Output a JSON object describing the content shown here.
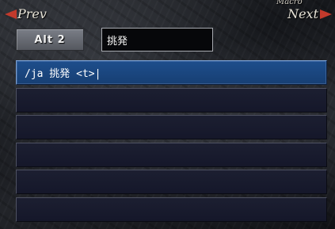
{
  "nav": {
    "prev_label": "Prev",
    "next_label": "Next",
    "caption": "Macro"
  },
  "macro": {
    "set_button_label": "Alt 2",
    "name_value": "挑発",
    "selected_index": 0,
    "lines": [
      "/ja 挑発 <t>|",
      "",
      "",
      "",
      "",
      ""
    ]
  },
  "colors": {
    "arrow": "#c23a2c",
    "selected_line": "#1e4e8c",
    "line_background": "#1c1f31"
  },
  "icons": {
    "prev": "left-triangle-arrow-icon",
    "next": "right-triangle-arrow-icon"
  }
}
